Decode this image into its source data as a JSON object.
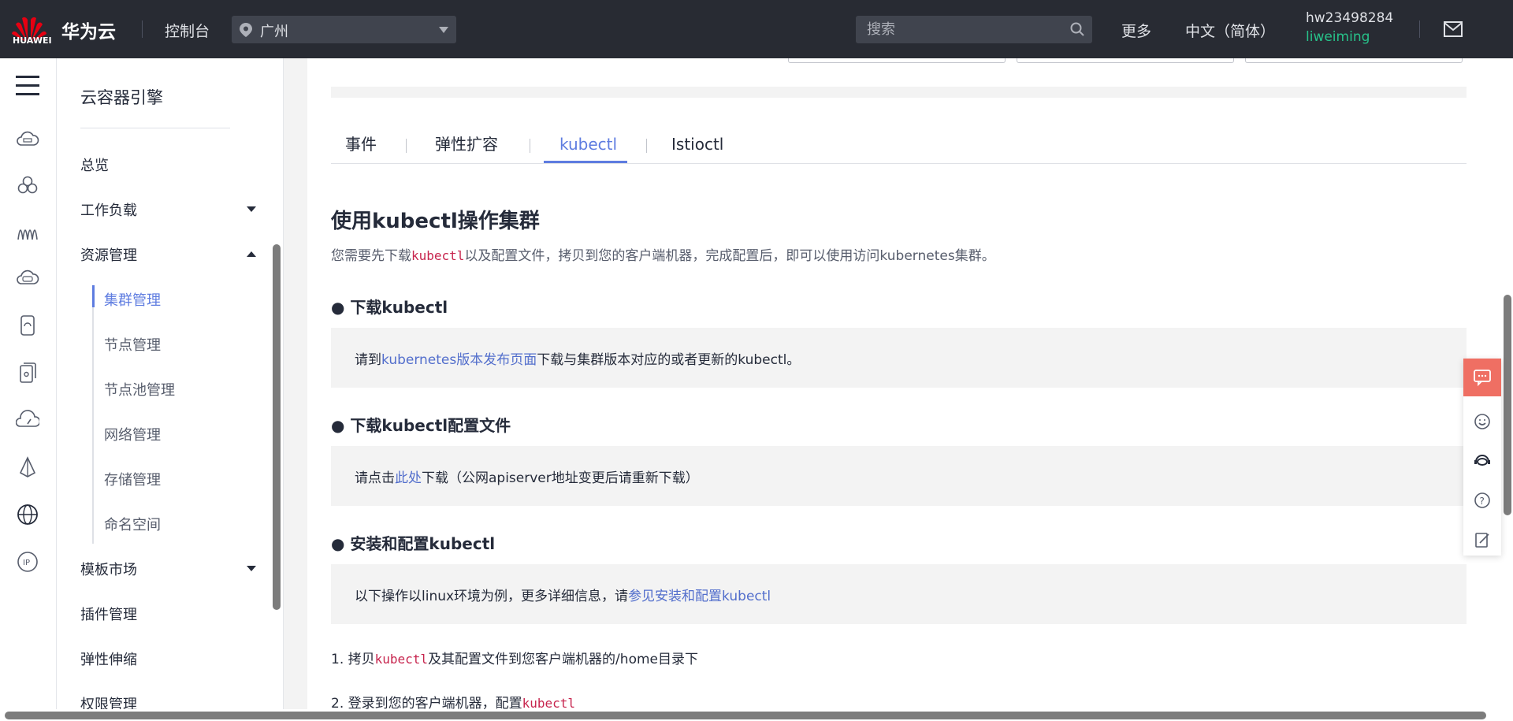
{
  "header": {
    "logo_text": "HUAWEI",
    "brand": "华为云",
    "console": "控制台",
    "region": "广州",
    "search_placeholder": "搜索",
    "more": "更多",
    "language": "中文（简体）",
    "account": "hw23498284",
    "username": "liweiming"
  },
  "rail": {
    "icons": [
      "cloud-server-icon",
      "cluster-icon",
      "function-icon",
      "cloud-db-icon",
      "phone-icon",
      "multi-device-icon",
      "dashboard-icon",
      "sail-icon",
      "globe-icon",
      "ip-icon"
    ]
  },
  "sidebar": {
    "title": "云容器引擎",
    "items": [
      {
        "label": "总览"
      },
      {
        "label": "工作负载"
      },
      {
        "label": "资源管理"
      },
      {
        "label": "模板市场"
      },
      {
        "label": "插件管理"
      },
      {
        "label": "弹性伸缩"
      },
      {
        "label": "权限管理"
      }
    ],
    "subitems": [
      {
        "label": "集群管理"
      },
      {
        "label": "节点管理"
      },
      {
        "label": "节点池管理"
      },
      {
        "label": "网络管理"
      },
      {
        "label": "存储管理"
      },
      {
        "label": "命名空间"
      }
    ]
  },
  "tabs": [
    {
      "label": "事件"
    },
    {
      "label": "弹性扩容"
    },
    {
      "label": "kubectl"
    },
    {
      "label": "Istioctl"
    }
  ],
  "content": {
    "title": "使用kubectl操作集群",
    "lead_pre": "您需要先下载",
    "lead_code": "kubectl",
    "lead_post": "以及配置文件，拷贝到您的客户端机器，完成配置后，即可以使用访问kubernetes集群。",
    "sec1_title": "● 下载kubectl",
    "sec1_pre": "请到",
    "sec1_link": "kubernetes版本发布页面",
    "sec1_post": "下载与集群版本对应的或者更新的kubectl。",
    "sec2_title": "● 下载kubectl配置文件",
    "sec2_pre": "请点击",
    "sec2_link": "此处",
    "sec2_post": "下载（公网apiserver地址变更后请重新下载）",
    "sec3_title": "● 安装和配置kubectl",
    "sec3_pre": "以下操作以linux环境为例，更多详细信息，请",
    "sec3_link": "参见安装和配置kubectl",
    "step1_pre": "1. 拷贝",
    "step1_code": "kubectl",
    "step1_post": "及其配置文件到您客户端机器的/home目录下",
    "step2_pre": "2. 登录到您的客户端机器，配置",
    "step2_code": "kubectl"
  },
  "float_panel": {
    "icons": [
      "feedback-icon",
      "smile-icon",
      "support-icon",
      "help-icon",
      "edit-note-icon"
    ]
  },
  "colors": {
    "topbar": "#282b33",
    "accent": "#5e7ce0",
    "link": "#526ecc",
    "code": "#c7254e",
    "user_green": "#27c28a",
    "float_red": "#ef6f63"
  }
}
